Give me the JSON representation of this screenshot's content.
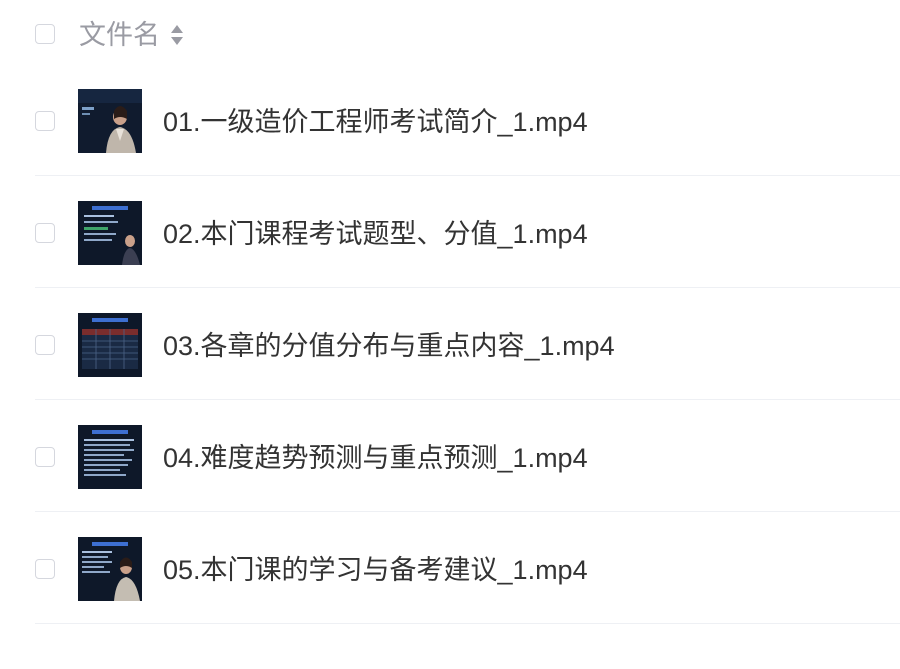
{
  "header": {
    "select_all": false,
    "column_label": "文件名",
    "sort_icon": "sort-updown-icon"
  },
  "files": [
    {
      "name": "01.一级造价工程师考试简介_1.mp4",
      "thumb": "video-thumbnail-presenter-icon"
    },
    {
      "name": "02.本门课程考试题型、分值_1.mp4",
      "thumb": "video-thumbnail-slides-icon"
    },
    {
      "name": "03.各章的分值分布与重点内容_1.mp4",
      "thumb": "video-thumbnail-table-icon"
    },
    {
      "name": "04.难度趋势预测与重点预测_1.mp4",
      "thumb": "video-thumbnail-text-icon"
    },
    {
      "name": "05.本门课的学习与备考建议_1.mp4",
      "thumb": "video-thumbnail-presenter-icon"
    }
  ],
  "colors": {
    "checkbox_border": "#d5d7de",
    "header_text": "#9a9ba3",
    "text": "#333333",
    "divider": "#eef0f4",
    "thumb_bg": "#0f1a2c"
  }
}
